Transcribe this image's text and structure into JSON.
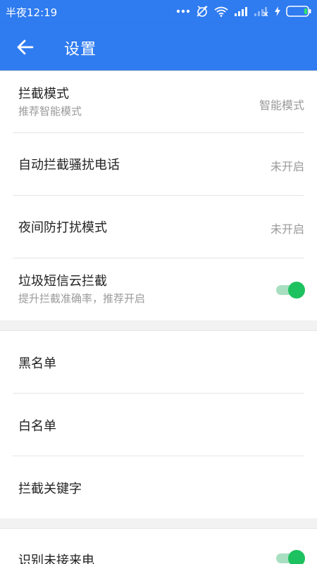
{
  "status_bar": {
    "time": "半夜12:19",
    "icons": [
      "more-dots-icon",
      "alarm-off-icon",
      "wifi-icon",
      "signal-icon",
      "signal-no-sim-icon",
      "charging-icon",
      "battery-icon"
    ]
  },
  "app_bar": {
    "title": "设置",
    "back_icon": "arrow-left-icon"
  },
  "colors": {
    "primary": "#2f7bf0",
    "toggle_on": "#1ec15f",
    "toggle_track": "#a9dfc1"
  },
  "group1": {
    "intercept_mode": {
      "title": "拦截模式",
      "subtitle": "推荐智能模式",
      "value": "智能模式"
    },
    "auto_block_calls": {
      "title": "自动拦截骚扰电话",
      "value": "未开启"
    },
    "night_dnd": {
      "title": "夜间防打扰模式",
      "value": "未开启"
    },
    "spam_sms_cloud": {
      "title": "垃圾短信云拦截",
      "subtitle": "提升拦截准确率，推荐开启",
      "enabled": true
    }
  },
  "group2": {
    "blacklist": {
      "title": "黑名单"
    },
    "whitelist": {
      "title": "白名单"
    },
    "keywords": {
      "title": "拦截关键字"
    }
  },
  "group3": {
    "identify_missed": {
      "title": "识别未接来电",
      "enabled": true
    }
  }
}
